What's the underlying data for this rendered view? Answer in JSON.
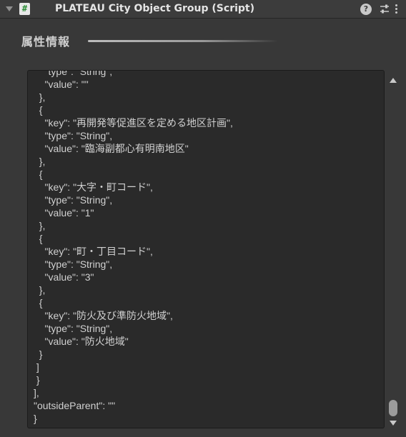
{
  "header": {
    "title": "PLATEAU City Object Group (Script)",
    "script_icon_glyph": "#",
    "help_glyph": "?"
  },
  "section": {
    "label": "属性情報"
  },
  "json_text": "    \"type\": \"String\",\n    \"value\": \"\"\n  },\n  {\n    \"key\": \"再開発等促進区を定める地区計画\",\n    \"type\": \"String\",\n    \"value\": \"臨海副都心有明南地区\"\n  },\n  {\n    \"key\": \"大字・町コード\",\n    \"type\": \"String\",\n    \"value\": \"1\"\n  },\n  {\n    \"key\": \"町・丁目コード\",\n    \"type\": \"String\",\n    \"value\": \"3\"\n  },\n  {\n    \"key\": \"防火及び準防火地域\",\n    \"type\": \"String\",\n    \"value\": \"防火地域\"\n  }\n ]\n }\n],\n\"outsideParent\": \"\"\n}",
  "icons": {
    "foldout": "triangle-down-icon",
    "script": "script-icon",
    "help": "help-icon",
    "preset": "preset-sliders-icon",
    "menu": "kebab-menu-icon"
  },
  "colors": {
    "background": "#383838",
    "header": "#3c3c3c",
    "json_box": "#2a2a2a",
    "text": "#d0d0d0"
  }
}
